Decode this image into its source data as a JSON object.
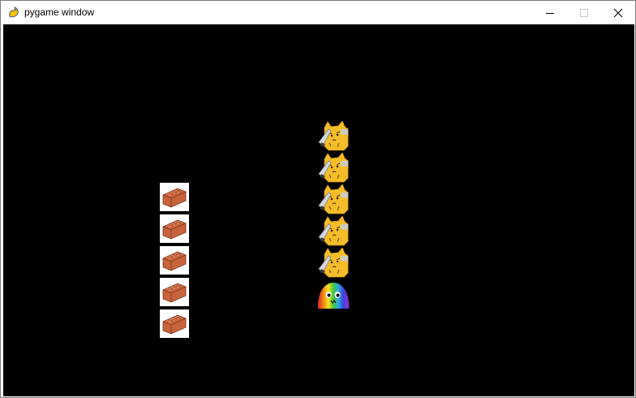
{
  "window": {
    "title": "pygame window",
    "icon": "pygame-snake-icon"
  },
  "controls": {
    "minimize_icon": "minimize-icon",
    "maximize_icon": "maximize-icon",
    "close_icon": "close-icon"
  },
  "game": {
    "background_color": "#000000",
    "brick_column": {
      "count": 5,
      "sprite": "brick-icon",
      "tile_color": "#ffffff",
      "brick_color": "#c8643c"
    },
    "enemy_column": {
      "count": 5,
      "sprite": "yellow-cat-knife-icon",
      "color": "#f6bd2a"
    },
    "player": {
      "sprite": "rainbow-blob-icon"
    }
  }
}
